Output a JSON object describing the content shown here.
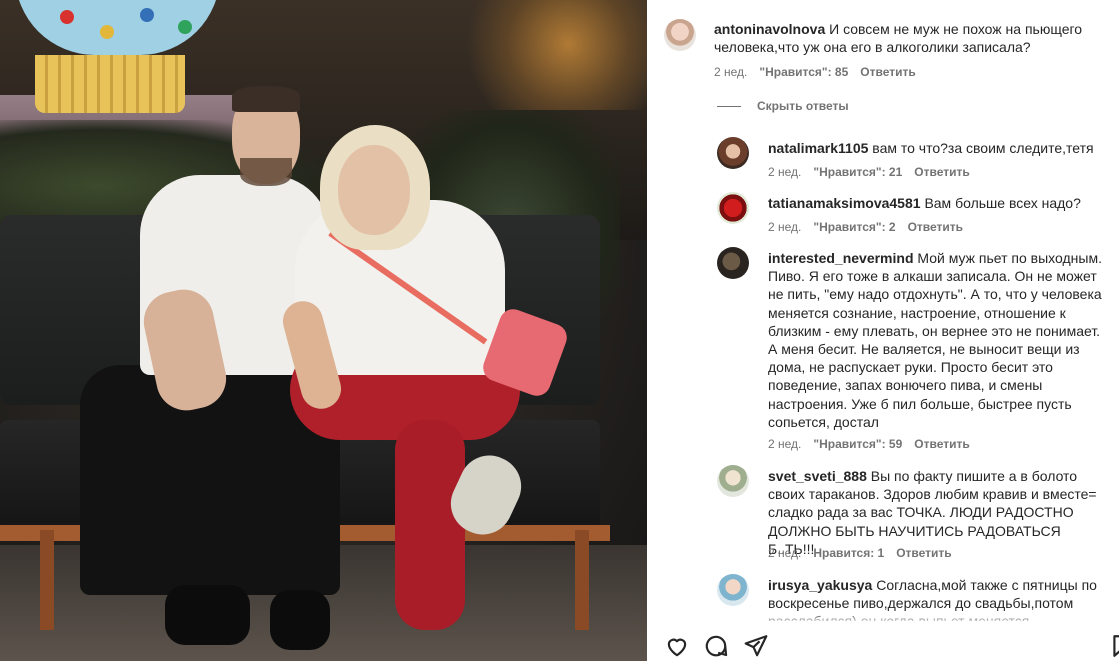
{
  "post_photo": {
    "alt": ""
  },
  "comments": [
    {
      "username": "antoninavolnova",
      "text": "И совсем не муж не похож на пьющего человека,что уж она его в алкоголики записала?",
      "time": "2 нед.",
      "likes": "\"Нравится\": 85",
      "reply": "Ответить"
    }
  ],
  "hide_replies_label": "Скрыть ответы",
  "replies": [
    {
      "username": "natalimark1105",
      "text": "вам то что?за своим следите,тетя",
      "time": "2 нед.",
      "likes": "\"Нравится\": 21",
      "reply": "Ответить"
    },
    {
      "username": "tatianamaksimova4581",
      "text": "Вам больше всех надо?",
      "time": "2 нед.",
      "likes": "\"Нравится\": 2",
      "reply": "Ответить"
    },
    {
      "username": "interested_nevermind",
      "text": "Мой муж пьет по выходным. Пиво. Я его тоже в алкаши записала. Он не может не пить, \"ему надо отдохнуть\". А то, что у человека меняется сознание, настроение, отношение к близким - ему плевать, он вернее это не понимает. А меня бесит. Не валяется, не выносит вещи из дома, не распускает руки. Просто бесит это поведение, запах вонючего пива, и смены настроения. Уже б пил больше, быстрее пусть сопьется, достал",
      "time": "2 нед.",
      "likes": "\"Нравится\": 59",
      "reply": "Ответить"
    },
    {
      "username": "svet_sveti_888",
      "text": "Вы по факту пишите а в болото своих тараканов. Здоров любим кравив и вместе= сладко рада за вас ТОЧКА. ЛЮДИ РАДОСТНО ДОЛЖНО БЫТЬ НАУЧИТИСЬ РАДОВАТЬСЯ Б..ТЬ!!!",
      "time": "2 нед.",
      "likes": "Нравится: 1",
      "reply": "Ответить"
    },
    {
      "username": "irusya_yakusya",
      "text": "Согласна,мой также с пятницы по воскресенье пиво,держался до свадьбы,потом расслабился) он когда выпьет меняется",
      "time": "",
      "likes": "",
      "reply": ""
    }
  ],
  "action_bar": {
    "like_icon": "heart-icon",
    "comment_icon": "comment-icon",
    "share_icon": "paper-plane-icon",
    "save_icon": "bookmark-icon"
  },
  "colors": {
    "text": "#262626",
    "muted": "#737373",
    "background": "#ffffff"
  }
}
